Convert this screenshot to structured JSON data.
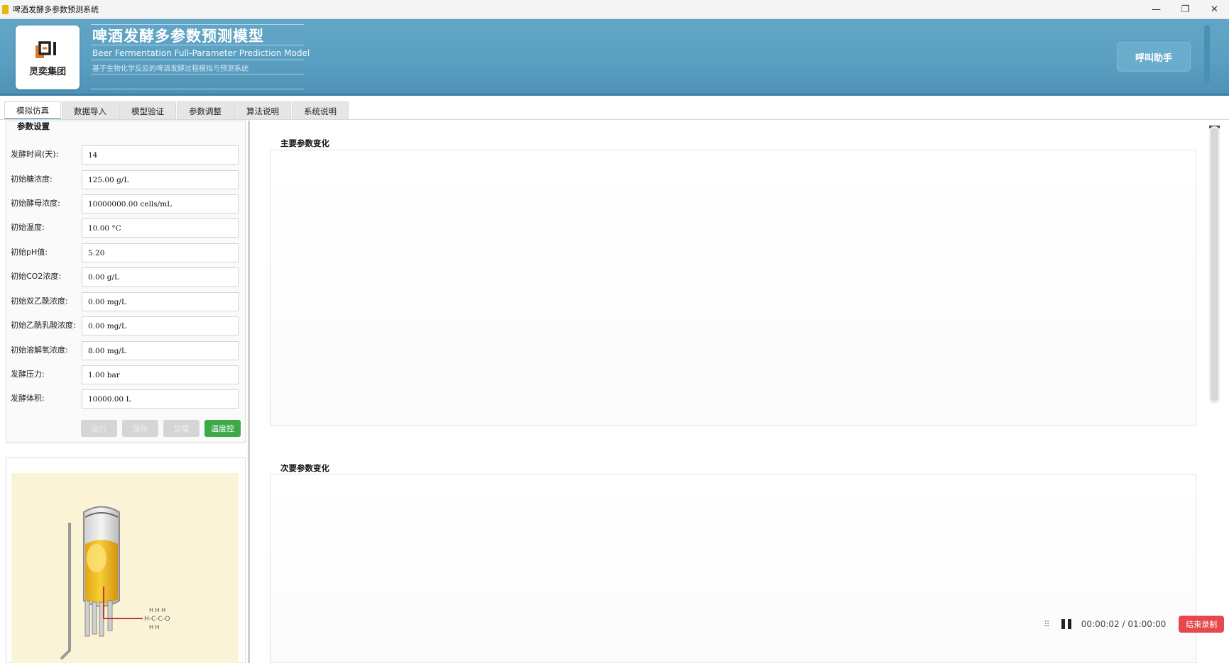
{
  "window": {
    "title": "啤酒发酵多参数预测系统",
    "controls": {
      "minimize": "—",
      "restore": "❐",
      "close": "✕"
    }
  },
  "header": {
    "logo_text": "灵奕集团",
    "title": "啤酒发酵多参数预测模型",
    "subtitle": "Beer Fermentation Full-Parameter Prediction Model",
    "description": "基于生物化学反应的啤酒发酵过程模拟与预测系统",
    "assistant_button": "呼叫助手"
  },
  "tabs": [
    "模拟仿真",
    "数据导入",
    "模型验证",
    "参数调整",
    "算法说明",
    "系统说明"
  ],
  "params": {
    "section_title": "参数设置",
    "rows": [
      {
        "label": "发酵时间(天):",
        "value": "14"
      },
      {
        "label": "初始糖浓度:",
        "value": "125.00 g/L"
      },
      {
        "label": "初始酵母浓度:",
        "value": "10000000.00 cells/mL"
      },
      {
        "label": "初始温度:",
        "value": "10.00 °C"
      },
      {
        "label": "初始pH值:",
        "value": "5.20"
      },
      {
        "label": "初始CO2浓度:",
        "value": "0.00 g/L"
      },
      {
        "label": "初始双乙酰浓度:",
        "value": "0.00 mg/L"
      },
      {
        "label": "初始乙酰乳酸浓度:",
        "value": "0.00 mg/L"
      },
      {
        "label": "初始溶解氧浓度:",
        "value": "8.00 mg/L"
      },
      {
        "label": "发酵压力:",
        "value": "1.00 bar"
      },
      {
        "label": "发酵体积:",
        "value": "10000.00 L"
      }
    ],
    "buttons": [
      "运行",
      "保存",
      "加载",
      "温度控"
    ]
  },
  "charts": {
    "primary_title": "主要参数变化",
    "secondary_title": "次要参数变化"
  },
  "recorder": {
    "time": "00:00:02 / 01:00:00",
    "stop_label": "结束录制"
  },
  "colors": {
    "banner": "#5a9fc1",
    "run_green": "#3daa49",
    "stop_red": "#e5484d"
  }
}
